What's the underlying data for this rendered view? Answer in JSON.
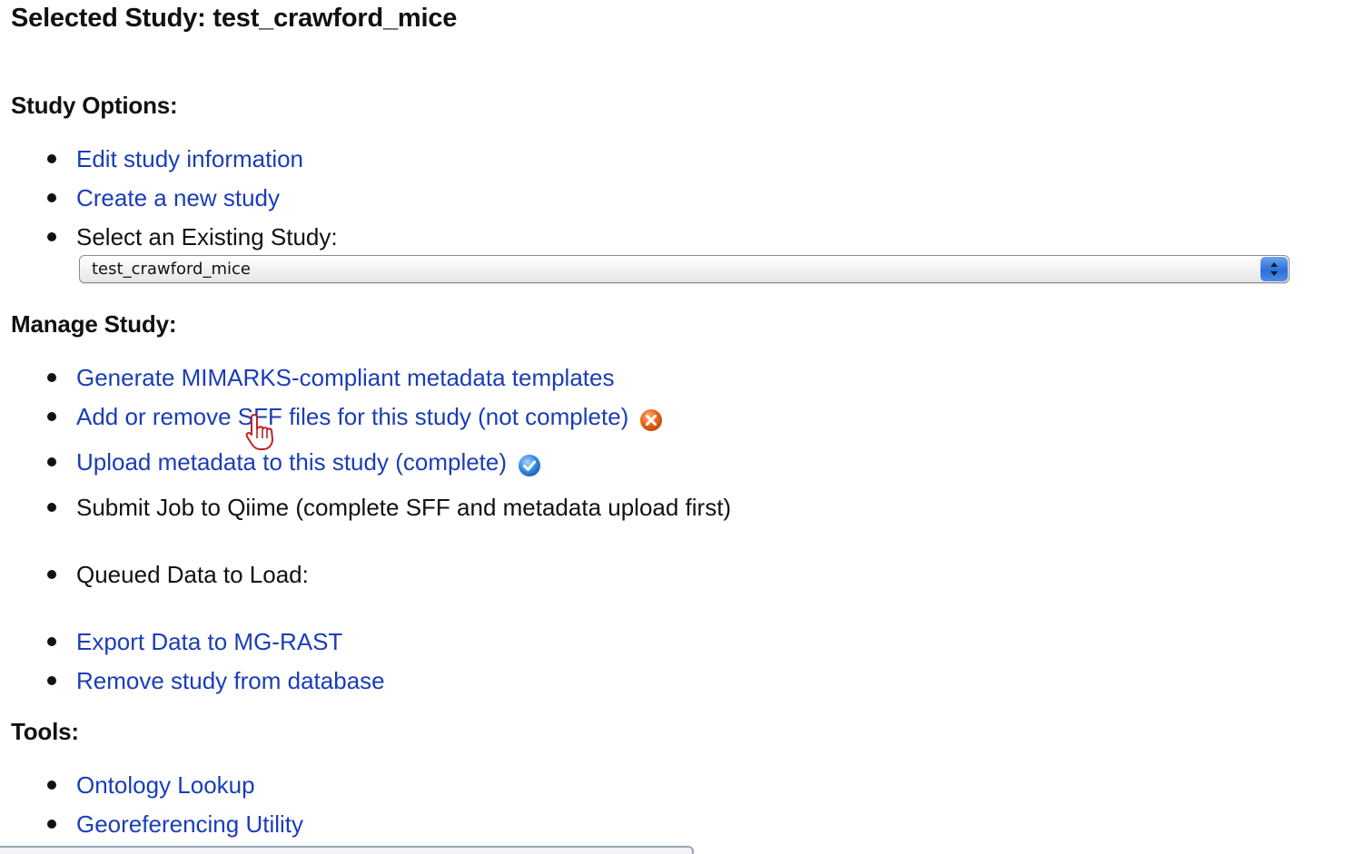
{
  "page": {
    "title": "Selected Study: test_crawford_mice"
  },
  "study_options": {
    "heading": "Study Options:",
    "edit_link": "Edit study information",
    "create_link": "Create a new study",
    "select_label": "Select an Existing Study:",
    "select_value": "test_crawford_mice"
  },
  "manage_study": {
    "heading": "Manage Study:",
    "generate_link": "Generate MIMARKS-compliant metadata templates",
    "sff_link": "Add or remove SFF files for this study (not complete)",
    "sff_status": "not-complete-icon",
    "metadata_link": "Upload metadata to this study (complete)",
    "metadata_status": "complete-check-icon",
    "submit_text": "Submit Job to Qiime (complete SFF and metadata upload first)",
    "queued_text": "Queued Data to Load:",
    "export_link": "Export Data to MG-RAST",
    "remove_link": "Remove study from database"
  },
  "tools": {
    "heading": "Tools:",
    "ontology_link": "Ontology Lookup",
    "geo_link": "Georeferencing Utility"
  },
  "colors": {
    "link": "#1a3db8",
    "text": "#111111",
    "incomplete": "#e8651f",
    "complete": "#3a8fe0"
  }
}
